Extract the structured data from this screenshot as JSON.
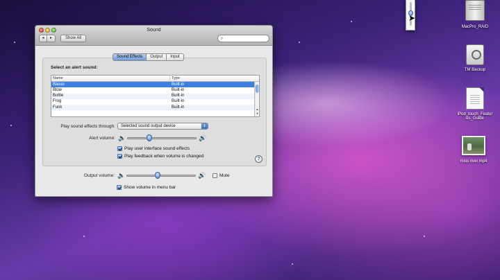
{
  "window": {
    "title": "Sound",
    "show_all_label": "Show All",
    "nav_back_glyph": "◂",
    "nav_forward_glyph": "▸",
    "search_placeholder": "",
    "search_icon": "magnifier-icon"
  },
  "tabs": [
    {
      "label": "Sound Effects",
      "active": true
    },
    {
      "label": "Output",
      "active": false
    },
    {
      "label": "Input",
      "active": false
    }
  ],
  "sound_effects": {
    "section_label": "Select an alert sound:",
    "columns": [
      "Name",
      "Type"
    ],
    "rows": [
      {
        "name": "Basso",
        "type": "Built-in",
        "selected": true
      },
      {
        "name": "Blow",
        "type": "Built-in",
        "selected": false
      },
      {
        "name": "Bottle",
        "type": "Built-in",
        "selected": false
      },
      {
        "name": "Frog",
        "type": "Built-in",
        "selected": false
      },
      {
        "name": "Funk",
        "type": "Built-in",
        "selected": false
      }
    ],
    "play_through_label": "Play sound effects through:",
    "play_through_value": "Selected sound output device",
    "alert_volume_label": "Alert volume:",
    "alert_volume_level": 0.3,
    "check_ui_sounds": {
      "label": "Play user interface sound effects",
      "checked": true
    },
    "check_feedback": {
      "label": "Play feedback when volume is changed",
      "checked": true
    },
    "help_label": "?"
  },
  "output": {
    "volume_label": "Output volume:",
    "volume_level": 0.45,
    "mute_label": "Mute",
    "mute_checked": false,
    "show_in_menubar": {
      "label": "Show volume in menu bar",
      "checked": true
    }
  },
  "desktop_icons": [
    {
      "label": "MacPro_RAID",
      "icon": "hard-drive-icon"
    },
    {
      "label": "TM Backup",
      "icon": "time-machine-drive-icon"
    },
    {
      "label": "iPod_touch_Features_Guide",
      "icon": "document-icon"
    },
    {
      "label": "miss river.mp4",
      "icon": "video-file-icon"
    }
  ],
  "menubar_volume_level": 0.6,
  "colors": {
    "selection": "#3d80df",
    "accent": "#6f9ad6"
  }
}
